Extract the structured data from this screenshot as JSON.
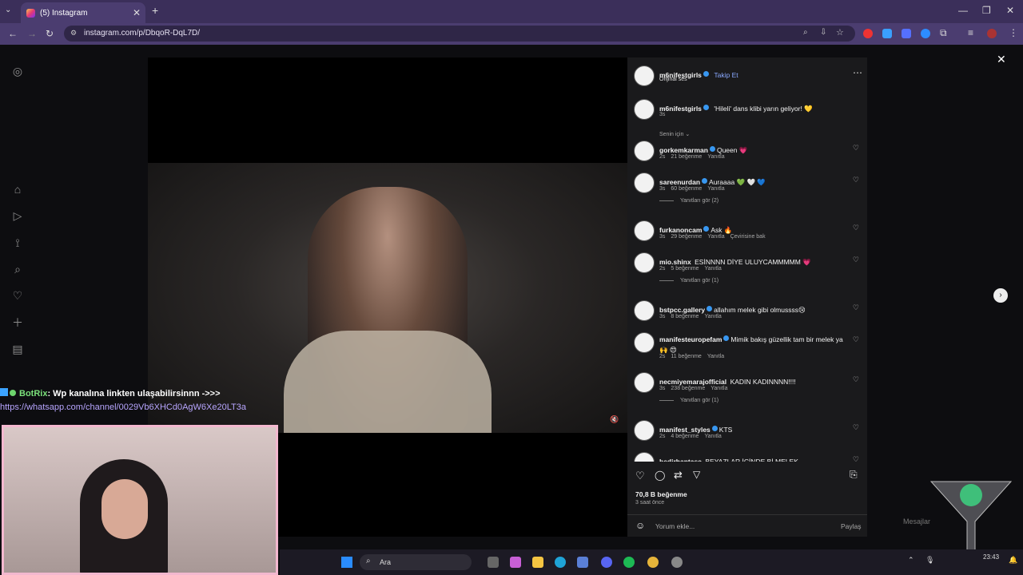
{
  "browser": {
    "tab_title": "(5) Instagram",
    "url": "instagram.com/p/DbqoR-DqL7D/"
  },
  "post": {
    "author": "m6nifestgirls",
    "follow_label": "Takip Et",
    "audio_label": "Orijinal ses",
    "more_icon": "more-icon",
    "caption": "'Hileli' dans klibi yarın geliyor! 💛",
    "caption_time": "3s",
    "sort_label": "Senin için",
    "likes": "70,8 B beğenme",
    "posted": "3 saat önce",
    "comment_placeholder": "Yorum ekle...",
    "share_label": "Paylaş"
  },
  "comments": [
    {
      "user": "gorkemkarman",
      "verified": true,
      "text": "Queen 💗",
      "time": "2s",
      "likes": "21 beğenme",
      "reply": "Yanıtla"
    },
    {
      "user": "sareenurdan",
      "verified": true,
      "text": "Auraaaa 💚 🤍 💙",
      "time": "3s",
      "likes": "60 beğenme",
      "reply": "Yanıtla",
      "replies": "Yanıtları gör (2)"
    },
    {
      "user": "furkanoncam",
      "verified": true,
      "text": "Ask 🔥",
      "time": "3s",
      "likes": "29 beğenme",
      "reply": "Yanıtla",
      "translate": "Çevirisine bak"
    },
    {
      "user": "mio.shinx",
      "verified": false,
      "text": "ESİNNNN DİYE ULUYCAMMMMM 💗",
      "time": "2s",
      "likes": "5 beğenme",
      "reply": "Yanıtla",
      "replies": "Yanıtları gör (1)"
    },
    {
      "user": "bstpcc.gallery",
      "verified": true,
      "text": "allahım melek gibi olmussss😢",
      "time": "3s",
      "likes": "8 beğenme",
      "reply": "Yanıtla"
    },
    {
      "user": "manifesteuropefam",
      "verified": true,
      "text": "Mimik bakış güzellik tam bir melek ya 🙌 😍",
      "time": "2s",
      "likes": "11 beğenme",
      "reply": "Yanıtla"
    },
    {
      "user": "necmiyemarajofficial",
      "verified": false,
      "text": "KADIN KADINNNN!!!!",
      "time": "3s",
      "likes": "238 beğenme",
      "reply": "Yanıtla",
      "replies": "Yanıtları gör (1)"
    },
    {
      "user": "manifest_styles",
      "verified": true,
      "text": "KTS",
      "time": "2s",
      "likes": "4 beğenme",
      "reply": "Yanıtla"
    },
    {
      "user": "bedirhantasc",
      "verified": false,
      "text": "BEYAZLAR İÇİNDE Bİ MELEK",
      "time": "",
      "likes": "",
      "reply": ""
    }
  ],
  "overlay": {
    "bot_name": "BotRix",
    "bot_message": ": Wp kanalına linkten ulaşabilirsinnn ->>>",
    "bot_link": "https://whatsapp.com/channel/0029Vb6XHCd0AgW6Xe20LT3a"
  },
  "taskbar": {
    "search_label": "Ara",
    "clock": "23:43",
    "messages_label": "Mesajlar"
  },
  "colors": {
    "chrome": "#3b2f5a",
    "panel": "#1a1a1c",
    "link": "#8aa9ff",
    "bot": "#7be07b"
  }
}
